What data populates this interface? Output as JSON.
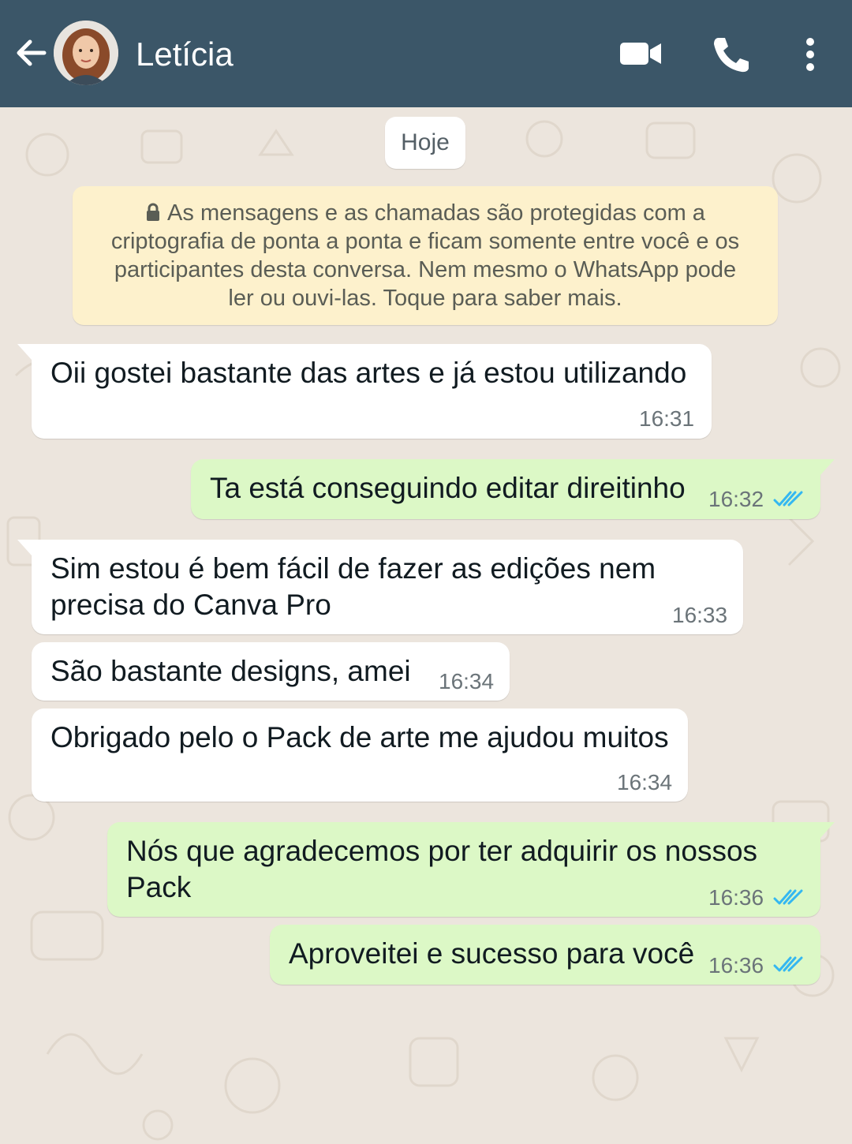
{
  "header": {
    "contact_name": "Letícia",
    "icons": [
      "back-arrow-icon",
      "avatar",
      "video-call-icon",
      "phone-icon",
      "more-options-icon"
    ],
    "background_color": "#3b5668"
  },
  "chat": {
    "date_label": "Hoje",
    "encryption_notice": "As mensagens e as chamadas são protegidas com a criptografia de ponta a ponta e ficam somente entre você e os participantes desta conversa. Nem mesmo o WhatsApp pode ler ou ouvi-las. Toque para saber mais.",
    "encryption_lines": [
      "As mensagens e as chamadas são protegidas com a",
      "criptografia de ponta a ponta e ficam somente entre você e os",
      "participantes desta conversa. Nem mesmo o WhatsApp pode",
      "ler ou ouvi-las. Toque para saber mais."
    ],
    "messages": [
      {
        "direction": "incoming",
        "lines": [
          "Oii gostei bastante das artes e já estou utilizando"
        ],
        "time": "16:31"
      },
      {
        "direction": "outgoing",
        "lines": [
          "Ta está conseguindo editar direitinho"
        ],
        "time": "16:32",
        "status": "read"
      },
      {
        "direction": "incoming",
        "lines": [
          "Sim estou é bem fácil de fazer as edições nem",
          "precisa do Canva Pro"
        ],
        "time": "16:33"
      },
      {
        "direction": "incoming",
        "lines": [
          "São bastante designs, amei"
        ],
        "time": "16:34"
      },
      {
        "direction": "incoming",
        "lines": [
          "Obrigado pelo o Pack de arte me ajudou muitos"
        ],
        "time": "16:34"
      },
      {
        "direction": "outgoing",
        "lines": [
          "Nós que agradecemos por ter adquirir os nossos",
          "Pack"
        ],
        "time": "16:36",
        "status": "read"
      },
      {
        "direction": "outgoing",
        "lines": [
          "Aproveitei e sucesso para você"
        ],
        "time": "16:36",
        "status": "read"
      }
    ]
  },
  "colors": {
    "incoming_bubble": "#ffffff",
    "outgoing_bubble": "#dcf8c6",
    "chat_background": "#ece5dd",
    "read_ticks": "#34b7f1",
    "notice_background": "#fdf1cc"
  }
}
